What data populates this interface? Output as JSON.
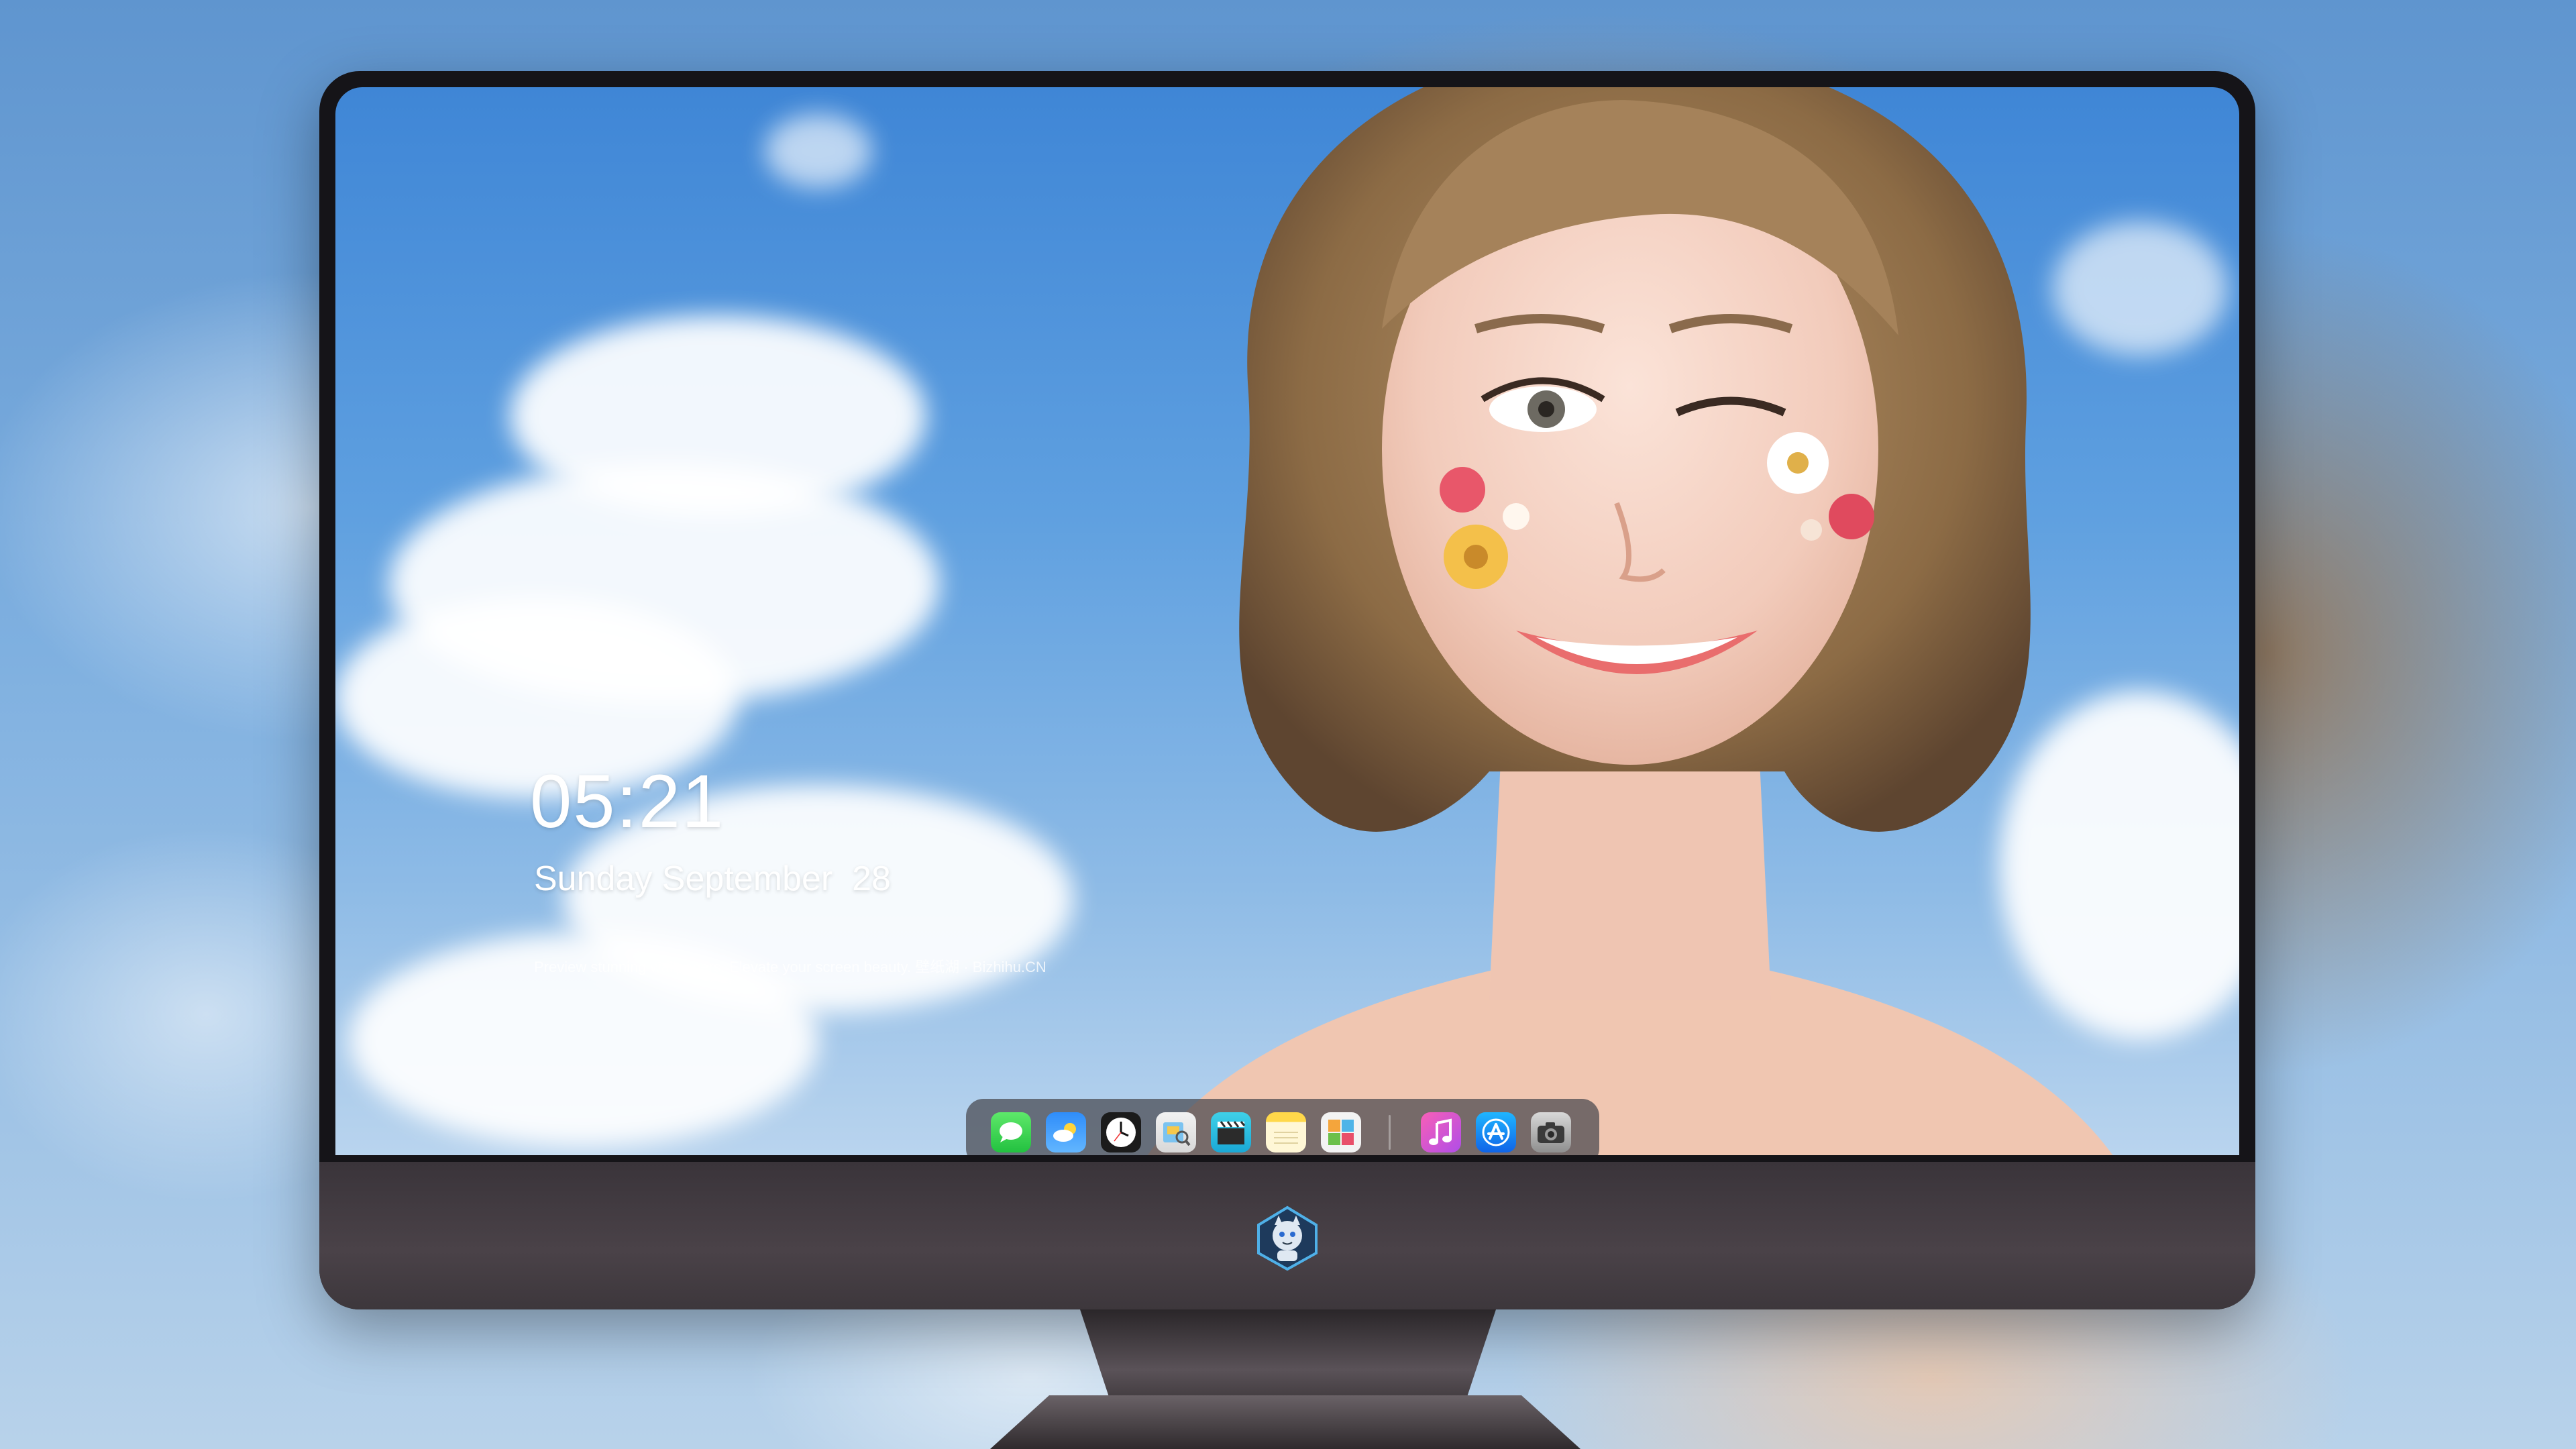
{
  "lock_screen": {
    "time": "05:21",
    "date": "Sunday September  28",
    "tagline": "Preview stunning wallpapers. Elevate your screen beauty. 壁纸湖 · Bizhihu.CN"
  },
  "dock": {
    "apps": [
      {
        "name": "Messages",
        "icon": "messages-icon"
      },
      {
        "name": "Weather",
        "icon": "weather-icon"
      },
      {
        "name": "Clock",
        "icon": "clock-icon"
      },
      {
        "name": "Preview",
        "icon": "preview-icon"
      },
      {
        "name": "Video",
        "icon": "clapperboard-icon"
      },
      {
        "name": "Notes",
        "icon": "notes-icon"
      },
      {
        "name": "Photos",
        "icon": "photos-icon"
      },
      {
        "name": "Music",
        "icon": "music-note-icon"
      },
      {
        "name": "App Store",
        "icon": "app-store-icon"
      },
      {
        "name": "Camera",
        "icon": "camera-icon"
      }
    ]
  },
  "monitor": {
    "logo": "mascot-logo-icon"
  },
  "colors": {
    "sky": "#5fa0e0",
    "bezel": "#151418",
    "chin": "#4a4248",
    "dock_bg": "#46464e"
  }
}
